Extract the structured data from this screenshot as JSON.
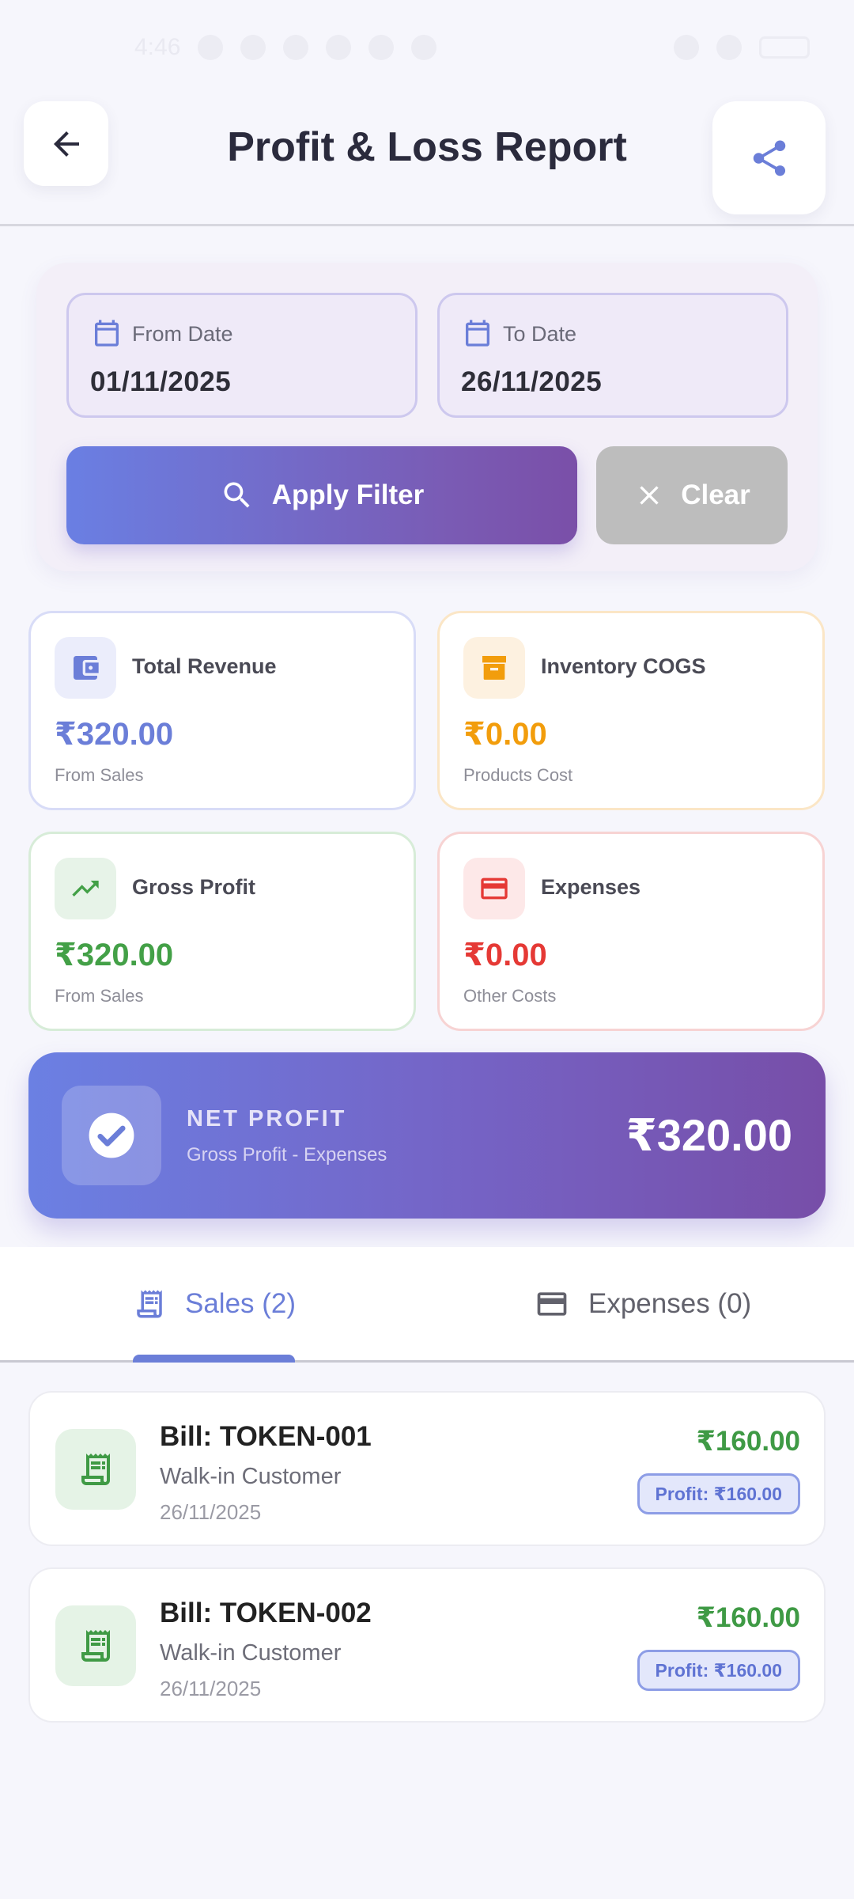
{
  "status_bar": {
    "time": "4:46"
  },
  "header": {
    "title": "Profit & Loss Report"
  },
  "filter": {
    "from_label": "From Date",
    "from_value": "01/11/2025",
    "to_label": "To Date",
    "to_value": "26/11/2025",
    "apply_label": "Apply Filter",
    "clear_label": "Clear"
  },
  "stats": {
    "revenue": {
      "label": "Total Revenue",
      "value": "₹320.00",
      "sub": "From Sales",
      "color": "#6b7ed8"
    },
    "cogs": {
      "label": "Inventory COGS",
      "value": "₹0.00",
      "sub": "Products Cost",
      "color": "#f29d0c"
    },
    "gross": {
      "label": "Gross Profit",
      "value": "₹320.00",
      "sub": "From Sales",
      "color": "#43a047"
    },
    "expenses": {
      "label": "Expenses",
      "value": "₹0.00",
      "sub": "Other Costs",
      "color": "#e53935"
    }
  },
  "net_profit": {
    "title": "NET PROFIT",
    "sub": "Gross Profit - Expenses",
    "value": "₹320.00"
  },
  "tabs": [
    {
      "label": "Sales (2)",
      "icon": "receipt-icon",
      "active": true
    },
    {
      "label": "Expenses (0)",
      "icon": "card-icon",
      "active": false
    }
  ],
  "bills": [
    {
      "title": "Bill: TOKEN-001",
      "customer": "Walk-in Customer",
      "date": "26/11/2025",
      "amount": "₹160.00",
      "profit": "Profit: ₹160.00"
    },
    {
      "title": "Bill: TOKEN-002",
      "customer": "Walk-in Customer",
      "date": "26/11/2025",
      "amount": "₹160.00",
      "profit": "Profit: ₹160.00"
    }
  ]
}
